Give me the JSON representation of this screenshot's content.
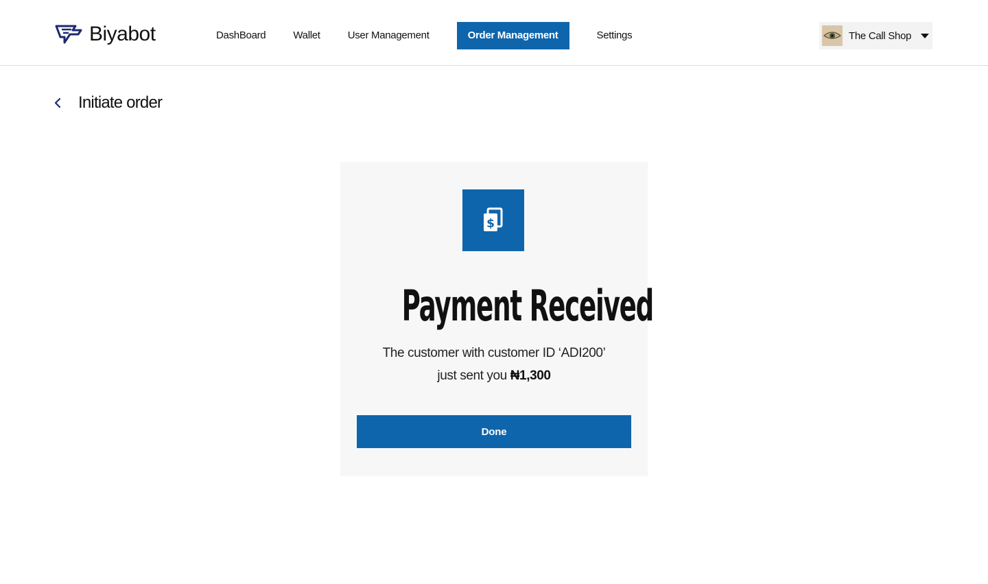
{
  "app": {
    "brand": "Biyabot"
  },
  "nav": {
    "items": [
      {
        "label": "DashBoard",
        "active": false
      },
      {
        "label": "Wallet",
        "active": false
      },
      {
        "label": "User Management",
        "active": false
      },
      {
        "label": "Order Management",
        "active": true
      },
      {
        "label": "Settings",
        "active": false
      }
    ]
  },
  "account": {
    "name": "The Call Shop",
    "avatar_icon": "eye-icon"
  },
  "page": {
    "title": "Initiate order",
    "back_icon": "chevron-left-icon"
  },
  "modal": {
    "icon": "payment-receipt-icon",
    "title": "Payment Received",
    "message_prefix": "The customer with customer ID ‘ADI200’",
    "message_line2": "just sent you ",
    "amount": "₦1,300",
    "done_label": "Done"
  },
  "colors": {
    "accent": "#0f65ab",
    "card_bg": "#f7f7f7",
    "text": "#111111"
  }
}
